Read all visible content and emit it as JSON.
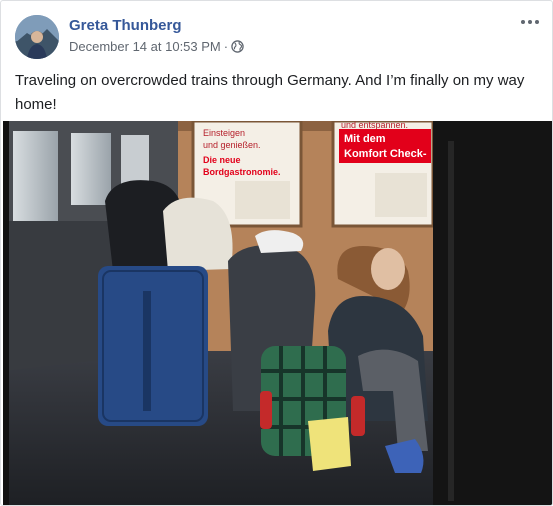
{
  "post": {
    "author": "Greta Thunberg",
    "timestamp": "December 14 at 10:53 PM",
    "separator": "·",
    "privacy_icon": "globe-icon",
    "menu_icon": "more-options-icon",
    "text": "Traveling on overcrowded trains through Germany. And I’m finally on my way home!"
  },
  "photo": {
    "sign_left": {
      "line1": "Einsteigen",
      "line2": "und genießen.",
      "line3": "Die neue",
      "line4": "Bordgastronomie."
    },
    "sign_right": {
      "line0": "und entspannen.",
      "line1": "Mit dem",
      "line2": "Komfort Check-"
    }
  },
  "colors": {
    "author_link": "#365899",
    "meta_text": "#606770",
    "db_red": "#e2001a"
  }
}
